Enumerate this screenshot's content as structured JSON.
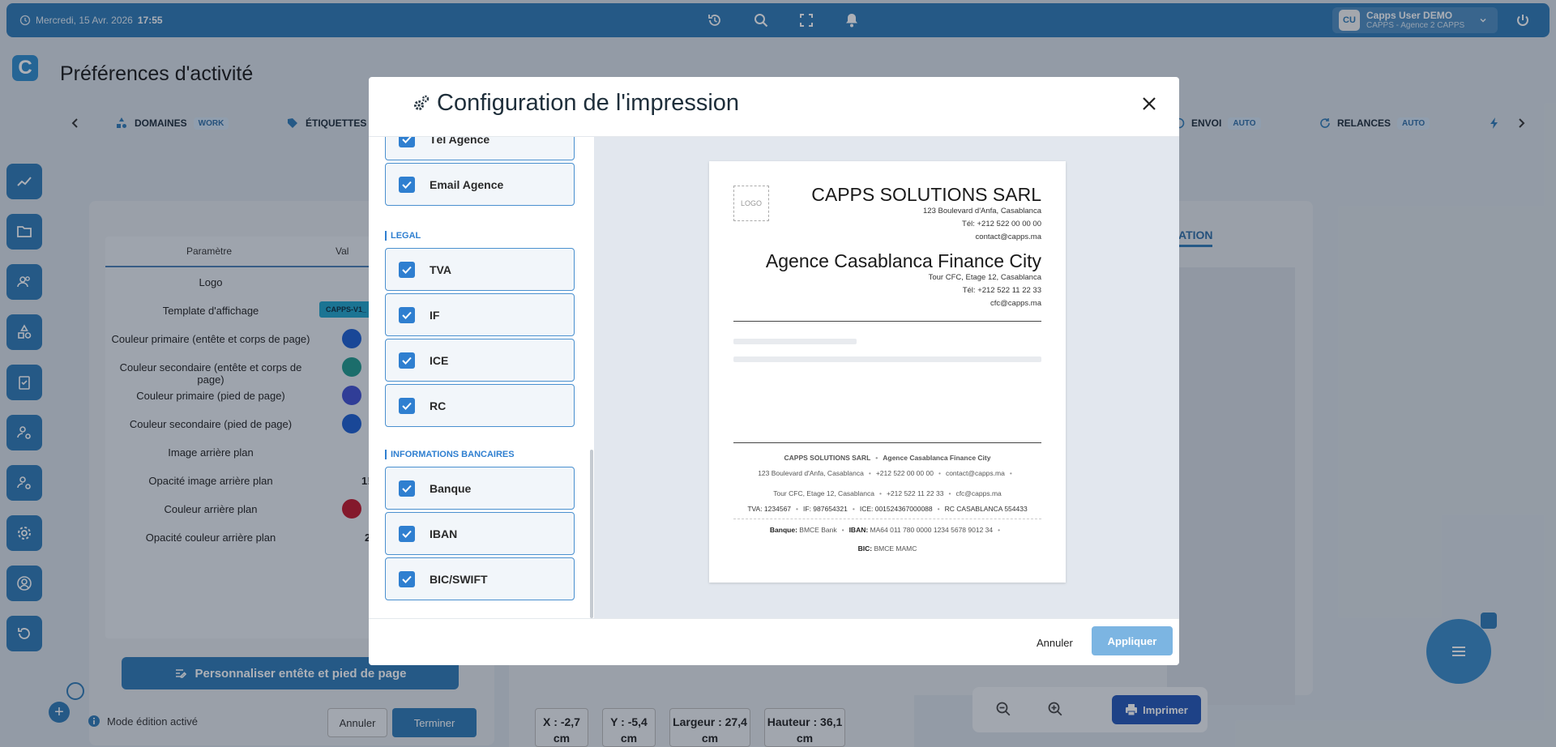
{
  "topbar": {
    "date": "Mercredi, 15 Avr. 2026",
    "time": "17:55",
    "user": {
      "initials": "CU",
      "name": "Capps User DEMO",
      "agency": "CAPPS - Agence 2 CAPPS"
    }
  },
  "page": {
    "logo_letter": "C",
    "title": "Préférences d'activité"
  },
  "sidebar": {
    "items": [
      "chart-icon",
      "folder-icon",
      "users-icon",
      "shapes-icon",
      "clipboard-icon",
      "user-cog-icon",
      "user-cog-2-icon",
      "settings-icon",
      "account-icon",
      "history-icon"
    ]
  },
  "tabs": [
    {
      "label": "DOMAINES",
      "tag": "WORK"
    },
    {
      "label": "ÉTIQUETTES",
      "tag": ""
    },
    {
      "label": "ENVOI",
      "tag": "AUTO"
    },
    {
      "label": "RELANCES",
      "tag": "AUTO"
    }
  ],
  "param_table": {
    "headers": [
      "Paramètre",
      "Val"
    ],
    "rows": [
      "Logo",
      "Template d'affichage",
      "Couleur primaire (entête et corps de page)",
      "Couleur secondaire (entête et corps de page)",
      "Couleur primaire (pied de page)",
      "Couleur secondaire (pied de page)",
      "Image arrière plan",
      "Opacité image arrière plan",
      "Couleur arrière plan",
      "Opacité couleur arrière plan"
    ],
    "template_value": "CAPPS-V1_",
    "opacity_image_value": "1!",
    "opacity_color_value": "2",
    "colors": [
      "#1c5fcf",
      "#20998c",
      "#3f4fcf",
      "#1c5fcf",
      "#c0182c"
    ]
  },
  "background": {
    "perso_button": "Personnaliser entête et pied de page",
    "mode_edition": "Mode édition activé",
    "annuler": "Annuler",
    "terminer": "Terminer",
    "stats": [
      "X : -2,7 cm",
      "Y : -5,4 cm",
      "Largeur : 27,4 cm",
      "Hauteur : 36,1 cm"
    ],
    "right_tab": "ATION",
    "imprimer": "Imprimer"
  },
  "modal": {
    "title": "Configuration de l'impression",
    "sections": {
      "agence_items": [
        "Tél Agence",
        "Email Agence"
      ],
      "legal_label": "LEGAL",
      "legal_items": [
        "TVA",
        "IF",
        "ICE",
        "RC"
      ],
      "bank_label": "INFORMATIONS BANCAIRES",
      "bank_items": [
        "Banque",
        "IBAN",
        "BIC/SWIFT"
      ]
    },
    "annuler": "Annuler",
    "appliquer": "Appliquer"
  },
  "preview": {
    "logo_placeholder": "LOGO",
    "company": "CAPPS SOLUTIONS SARL",
    "company_address": "123 Boulevard d'Anfa, Casablanca",
    "company_phone": "Tél: +212 522 00 00 00",
    "company_email": "contact@capps.ma",
    "agency": "Agence Casablanca Finance City",
    "agency_address": "Tour CFC, Etage 12, Casablanca",
    "agency_phone": "Tél: +212 522 11 22 33",
    "agency_email": "cfc@capps.ma",
    "footer": {
      "company": "CAPPS SOLUTIONS SARL",
      "agency": "Agence Casablanca Finance City",
      "line1": [
        "123 Boulevard d'Anfa, Casablanca",
        "+212 522 00 00 00",
        "contact@capps.ma"
      ],
      "line2": [
        "Tour CFC, Etage 12, Casablanca",
        "+212 522 11 22 33",
        "cfc@capps.ma"
      ],
      "legal": [
        "TVA: 1234567",
        "IF: 987654321",
        "ICE: 001524367000088",
        "RC CASABLANCA 554433"
      ],
      "bank_label": "Banque:",
      "bank_value": "BMCE Bank",
      "iban_label": "IBAN:",
      "iban_value": "MA64 011 780 0000 1234 5678 9012 34",
      "bic_label": "BIC:",
      "bic_value": "BMCE MAMC"
    }
  }
}
